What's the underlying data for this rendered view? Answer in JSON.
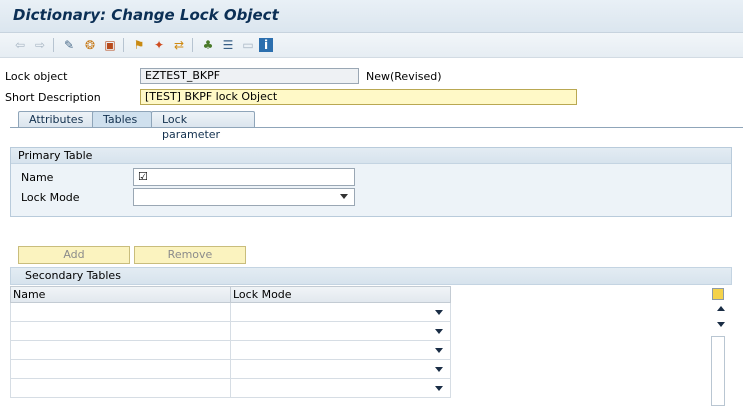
{
  "window": {
    "title": "Dictionary: Change Lock Object"
  },
  "toolbar": {
    "icons": [
      "back-arrow-icon",
      "forward-arrow-icon",
      "display-change-icon",
      "other-object-icon",
      "check-icon",
      "activate-icon",
      "where-used-icon",
      "object-list-icon",
      "hierarchy-icon",
      "display-object-list-icon",
      "documentation-icon",
      "info-icon"
    ]
  },
  "header": {
    "lock_object_label": "Lock object",
    "lock_object_value": "EZTEST_BKPF",
    "status": "New(Revised)",
    "short_desc_label": "Short Description",
    "short_desc_value": "[TEST] BKPF lock Object"
  },
  "tabs": [
    {
      "label": "Attributes",
      "active": false
    },
    {
      "label": "Tables",
      "active": true
    },
    {
      "label": "Lock parameter",
      "active": false
    }
  ],
  "primary_table": {
    "title": "Primary Table",
    "name_label": "Name",
    "name_value": "☑",
    "lock_mode_label": "Lock Mode",
    "lock_mode_value": ""
  },
  "buttons": {
    "add": "Add",
    "remove": "Remove"
  },
  "secondary_tables": {
    "title": "Secondary Tables",
    "columns": [
      "Name",
      "Lock Mode"
    ],
    "rows": [
      {
        "name": "",
        "lock_mode": ""
      },
      {
        "name": "",
        "lock_mode": ""
      },
      {
        "name": "",
        "lock_mode": ""
      },
      {
        "name": "",
        "lock_mode": ""
      },
      {
        "name": "",
        "lock_mode": ""
      }
    ]
  }
}
